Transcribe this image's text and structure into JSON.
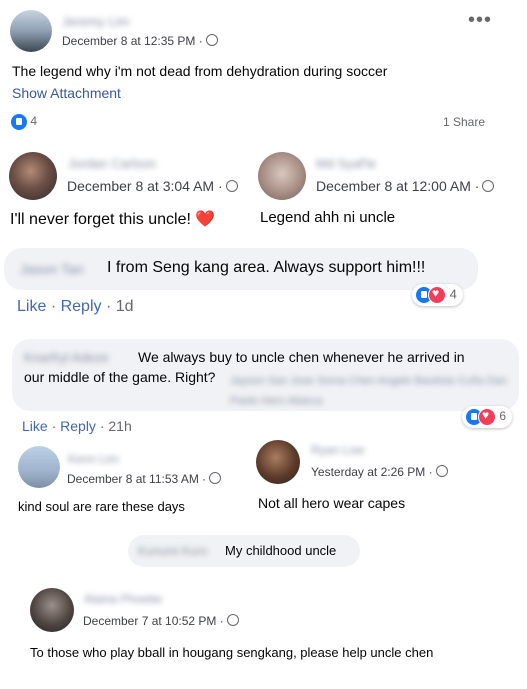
{
  "post": {
    "author": "Jeremy Lim",
    "time": "December 8 at 12:35 PM ·",
    "text": "The legend why i'm not dead from dehydration during soccer",
    "show_attachment": "Show Attachment",
    "likes": "4",
    "shares": "1 Share",
    "more_icon": "more-horizontal-icon"
  },
  "comments": {
    "c1": {
      "author": "Jordan Carlson",
      "time": "December 8 at 3:04 AM ·",
      "text": "I'll never forget this uncle!",
      "emoji": "❤️"
    },
    "c2": {
      "author": "Md Syaf'ie",
      "time": "December 8 at 12:00 AM ·",
      "text": "Legend ahh ni uncle"
    },
    "c3": {
      "author": "Jason Tan",
      "text": "I from Seng kang area. Always support him!!!",
      "like": "Like",
      "reply": "Reply",
      "age": "· 1d",
      "reactions": "4"
    },
    "c4": {
      "author": "Knarfryl Adeze",
      "text1": "We always buy to uncle chen whenever he arrived in",
      "text2": "our middle of the game. Right?",
      "tags": "Jayson San Jose Soma Chen Angelo Bautista Cuña Dan Paolo Hern Abarca",
      "like": "Like",
      "reply": "Reply",
      "age": "· 21h",
      "reactions": "6"
    },
    "c5": {
      "author": "Kenn Lim",
      "time": "December 8 at 11:53 AM ·",
      "text": "kind soul are rare these days"
    },
    "c6": {
      "author": "Ryan Low",
      "time": "Yesterday at 2:26 PM ·",
      "text": "Not all hero wear capes"
    },
    "c7": {
      "author": "Kunumi Kuro",
      "text": "My childhood uncle"
    },
    "c8": {
      "author": "Alaina Phoebe",
      "time": "December 7 at 10:52 PM ·",
      "text": "To those who play bball in hougang sengkang, please help uncle chen"
    }
  },
  "colors": {
    "accent": "#1877f2",
    "heart": "#f33e58",
    "bubble": "#f0f2f5",
    "link": "#385898"
  }
}
